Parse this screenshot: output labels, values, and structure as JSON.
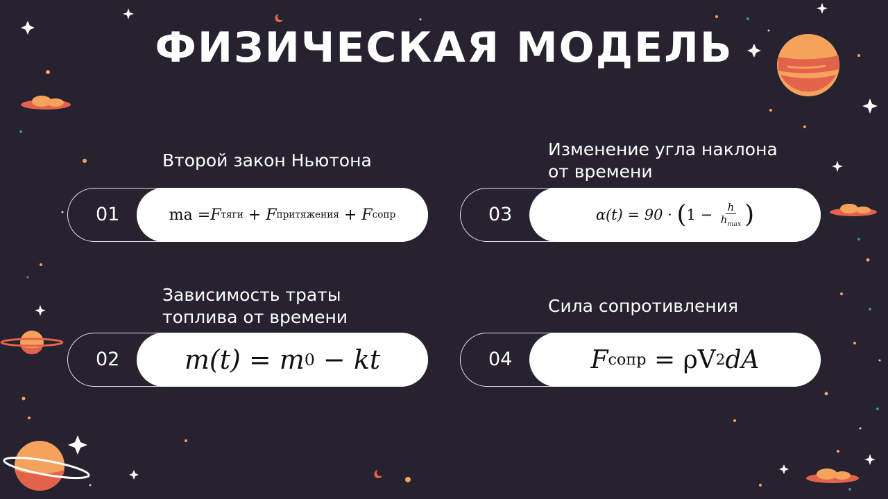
{
  "title": "ФИЗИЧЕСКАЯ МОДЕЛЬ",
  "items": [
    {
      "number": "01",
      "label": "Второй закон Ньютона",
      "formula": {
        "lhs": "ma = ",
        "f1": "F",
        "s1": "тяги",
        "plus1": " + ",
        "f2": "F",
        "s2": "притяжения",
        "plus2": " + ",
        "f3": "F",
        "s3": "сопр"
      }
    },
    {
      "number": "02",
      "label_line1": "Зависимость траты",
      "label_line2": "топлива от времени",
      "formula": {
        "a": "m(t) = m",
        "sub": "0",
        "b": " − kt"
      }
    },
    {
      "number": "03",
      "label_line1": "Изменение угла наклона",
      "label_line2": "от времени",
      "formula": {
        "a": "α(t) = 90 · ",
        "open": "(",
        "one": "1 − ",
        "num": "h",
        "den": "h",
        "den_sub": "max",
        "close": ")"
      }
    },
    {
      "number": "04",
      "label": "Сила сопротивления",
      "formula": {
        "f": "F",
        "sub": "сопр",
        "eq": " = ρV",
        "sup": "2",
        "rest": "dA"
      }
    }
  ],
  "colors": {
    "background": "#26222f",
    "planet_orange": "#f5a25d",
    "planet_red": "#e2634a",
    "cloud": "#f28a6a"
  }
}
